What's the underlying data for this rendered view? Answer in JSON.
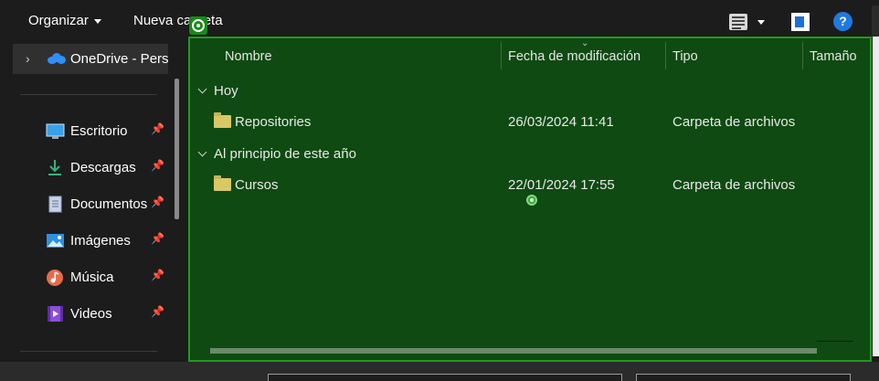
{
  "toolbar": {
    "organize_label": "Organizar",
    "new_folder_label": "Nueva carpeta",
    "help_glyph": "?"
  },
  "sidebar": {
    "onedrive_label": "OneDrive - Perso",
    "items": [
      {
        "label": "Escritorio",
        "icon": "desktop-icon"
      },
      {
        "label": "Descargas",
        "icon": "download-icon"
      },
      {
        "label": "Documentos",
        "icon": "documents-icon"
      },
      {
        "label": "Imágenes",
        "icon": "pictures-icon"
      },
      {
        "label": "Música",
        "icon": "music-icon"
      },
      {
        "label": "Videos",
        "icon": "videos-icon"
      }
    ]
  },
  "columns": {
    "name": "Nombre",
    "modified": "Fecha de modificación",
    "type": "Tipo",
    "size": "Tamaño"
  },
  "groups": [
    {
      "label": "Hoy",
      "rows": [
        {
          "name": "Repositories",
          "modified": "26/03/2024 11:41",
          "type": "Carpeta de archivos"
        }
      ]
    },
    {
      "label": "Al principio de este año",
      "rows": [
        {
          "name": "Cursos",
          "modified": "22/01/2024 17:55",
          "type": "Carpeta de archivos"
        }
      ]
    }
  ],
  "colors": {
    "selection_fill": "#0f4a12",
    "selection_border": "#1f9b1f",
    "folder": "#d9c866",
    "accent": "#1f7ae0"
  }
}
